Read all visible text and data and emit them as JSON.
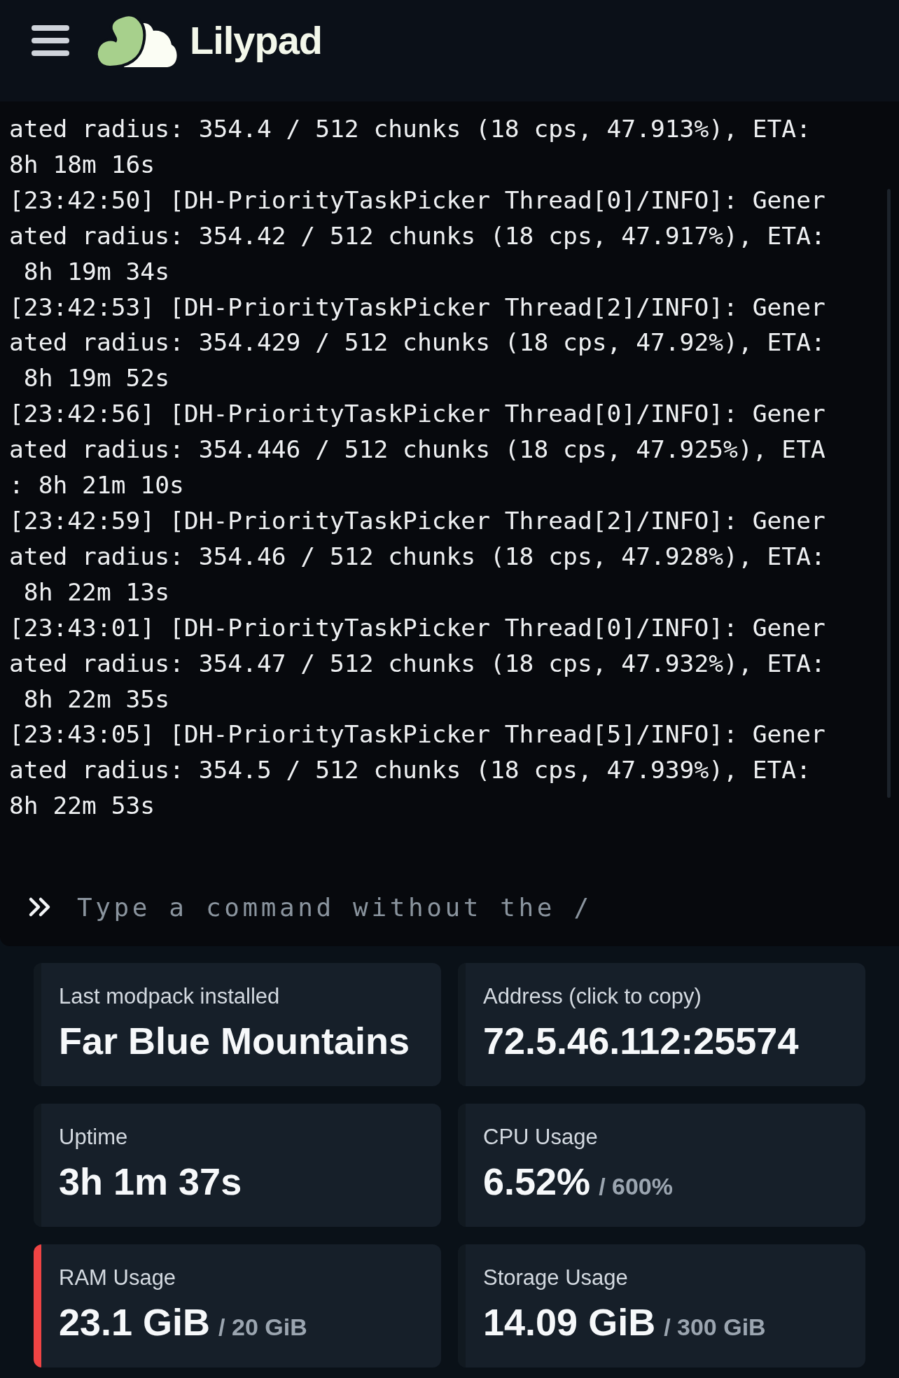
{
  "header": {
    "title": "Lilypad"
  },
  "console": {
    "lines": [
      "ated radius: 354.4 / 512 chunks (18 cps, 47.913%), ETA:",
      "8h 18m 16s",
      "[23:42:50] [DH-PriorityTaskPicker Thread[0]/INFO]: Gener",
      "ated radius: 354.42 / 512 chunks (18 cps, 47.917%), ETA:",
      " 8h 19m 34s",
      "[23:42:53] [DH-PriorityTaskPicker Thread[2]/INFO]: Gener",
      "ated radius: 354.429 / 512 chunks (18 cps, 47.92%), ETA:",
      " 8h 19m 52s",
      "[23:42:56] [DH-PriorityTaskPicker Thread[0]/INFO]: Gener",
      "ated radius: 354.446 / 512 chunks (18 cps, 47.925%), ETA",
      ": 8h 21m 10s",
      "[23:42:59] [DH-PriorityTaskPicker Thread[2]/INFO]: Gener",
      "ated radius: 354.46 / 512 chunks (18 cps, 47.928%), ETA:",
      " 8h 22m 13s",
      "[23:43:01] [DH-PriorityTaskPicker Thread[0]/INFO]: Gener",
      "ated radius: 354.47 / 512 chunks (18 cps, 47.932%), ETA:",
      " 8h 22m 35s",
      "[23:43:05] [DH-PriorityTaskPicker Thread[5]/INFO]: Gener",
      "ated radius: 354.5 / 512 chunks (18 cps, 47.939%), ETA:",
      "8h 22m 53s"
    ],
    "command": {
      "placeholder": "Type a command without the /"
    }
  },
  "stats": [
    {
      "label": "Last modpack installed",
      "value": "Far Blue Mountains",
      "alert": false
    },
    {
      "label": "Address (click to copy)",
      "value": "72.5.46.112:25574",
      "alert": false
    },
    {
      "label": "Uptime",
      "value": "3h 1m 37s",
      "alert": false
    },
    {
      "label": "CPU Usage",
      "value": "6.52%",
      "limit": "/ 600%",
      "alert": false
    },
    {
      "label": "RAM Usage",
      "value": "23.1 GiB",
      "limit": "/ 20 GiB",
      "alert": true
    },
    {
      "label": "Storage Usage",
      "value": "14.09 GiB",
      "limit": "/ 300 GiB",
      "alert": false
    }
  ]
}
